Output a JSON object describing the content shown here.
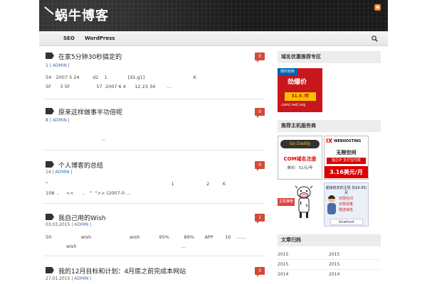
{
  "header": {
    "site_title": "蜗牛博客",
    "rss_label": "RSS"
  },
  "nav": {
    "items": [
      "SEO",
      "WordPress"
    ]
  },
  "posts": [
    {
      "title": "在家5分钟30秒搞定的",
      "comments": "0",
      "meta_prefix": "1",
      "author": "ADMIN",
      "excerpt_line1": "54   2007 5 24         d2    1              [d1,g1]                                 K",
      "excerpt_line2": "5F      3 5F                  57  2007 6 4      12 23 34        ..."
    },
    {
      "title": "原来这样做事半功倍呢",
      "comments": "0",
      "meta_prefix": "8",
      "author": "ADMIN",
      "excerpt_line1": "...",
      "excerpt_line2": ""
    },
    {
      "title": "个人博客的总结",
      "comments": "0",
      "meta_prefix": "14",
      "author": "ADMIN",
      "excerpt_line1": "\"                                                                                    1                      2         K",
      "excerpt_line2": "108  ,     <<      ,    \"  \">> (2007-0 ..."
    },
    {
      "title": "我自己用的Wish",
      "comments": "1",
      "meta_prefix": "03,03,2015",
      "author": "ADMIN",
      "excerpt_line1": "50                    wish                          wish             95%          89%       APP        10    ......",
      "excerpt_line2": "              wish                                                                       ..."
    },
    {
      "title": "我的12月目标和计划：4月底之前完成本网站",
      "comments": "3",
      "meta_prefix": "27,01,2015",
      "author": "ADMIN",
      "excerpt_line1": "",
      "excerpt_line2": ""
    }
  ],
  "sidebar": {
    "widget1_title": "域名优惠推荐专区",
    "ad1": {
      "tag": "限时抢购",
      "headline": "劲爆价",
      "price": "31.5 /年",
      "domains": ".com/.net/.org"
    },
    "widget2_title": "推荐主机服务商",
    "ad2": {
      "brand": "Go Daddy",
      "headline": "COM域名注册",
      "price": "单价：51元/年"
    },
    "ad3": {
      "logo": "IX",
      "logo_sub": "WEBHOSTING",
      "headline": "无限空间",
      "bar": "独立IP  支付宝付款",
      "price": "3.16美元/月"
    },
    "ad4": {
      "tag": "主机推荐"
    },
    "ad5": {
      "headline": "超级稳定的主机 仅$6.95/月",
      "features": [
        "无限空间",
        "无限流量",
        "赠送域名"
      ],
      "brand": "bluehost"
    },
    "widget3_title": "文章归档",
    "archives": [
      [
        "2015",
        "2015"
      ],
      [
        "2015",
        "2015"
      ],
      [
        "2014",
        "2014"
      ]
    ]
  },
  "colors": {
    "accent_red": "#d24a38",
    "link_blue": "#3b72b5"
  }
}
